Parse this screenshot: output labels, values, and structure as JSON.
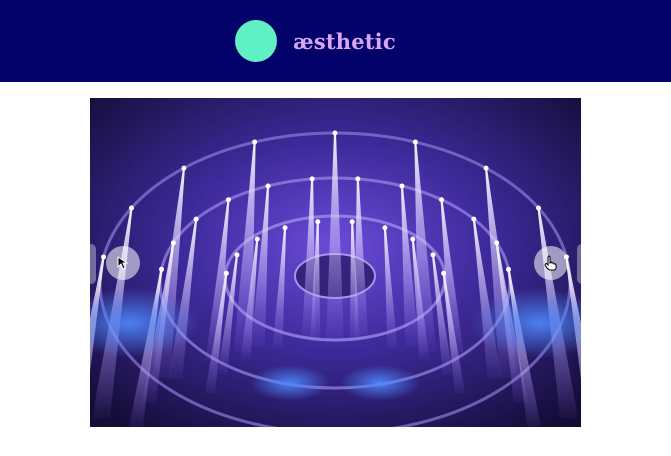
{
  "header": {
    "brand": "æsthetic",
    "logo_color": "#5ff0c4",
    "background": "#03026b",
    "brand_color": "#d9a6f4"
  },
  "carousel": {
    "slide_image": "concert-stage-lights-photo",
    "prev_icon": "cursor-pointer-icon",
    "next_icon": "hand-pointer-icon"
  }
}
